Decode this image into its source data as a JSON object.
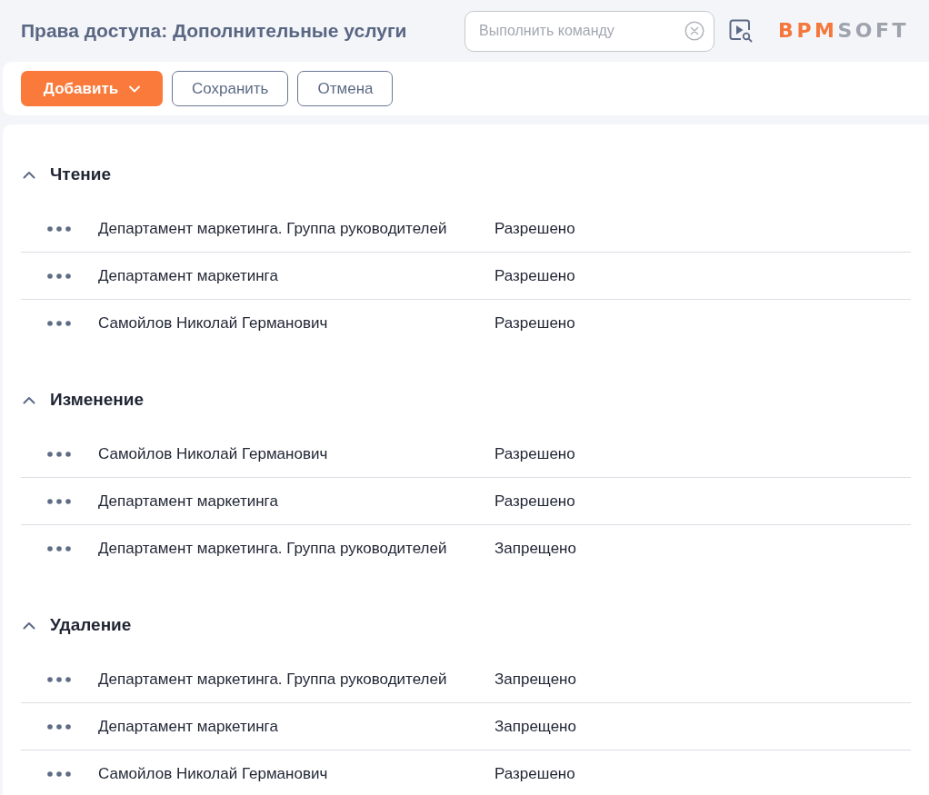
{
  "header": {
    "title": "Права доступа: Дополнительные услуги",
    "command_field": {
      "placeholder": "Выполнить команду"
    },
    "logo": {
      "accent": "BPM",
      "rest": "SOFT"
    }
  },
  "toolbar": {
    "buttons": [
      {
        "label": "Добавить",
        "kind": "primary"
      },
      {
        "label": "Сохранить",
        "kind": "outline"
      },
      {
        "label": "Отмена",
        "kind": "outline"
      }
    ]
  },
  "groups": [
    {
      "title": "Чтение",
      "expanded": true,
      "rows": [
        {
          "name": "Департамент маркетинга. Группа руководителей",
          "access": "Разрешено"
        },
        {
          "name": "Департамент маркетинга",
          "access": "Разрешено"
        },
        {
          "name": "Самойлов Николай Германович",
          "access": "Разрешено"
        }
      ]
    },
    {
      "title": "Изменение",
      "expanded": true,
      "rows": [
        {
          "name": "Самойлов Николай Германович",
          "access": "Разрешено"
        },
        {
          "name": "Департамент маркетинга",
          "access": "Разрешено"
        },
        {
          "name": "Департамент маркетинга. Группа руководителей",
          "access": "Запрещено"
        }
      ]
    },
    {
      "title": "Удаление",
      "expanded": true,
      "rows": [
        {
          "name": "Департамент маркетинга. Группа руководителей",
          "access": "Запрещено"
        },
        {
          "name": "Департамент маркетинга",
          "access": "Запрещено"
        },
        {
          "name": "Самойлов Николай Германович",
          "access": "Разрешено"
        }
      ]
    }
  ]
}
